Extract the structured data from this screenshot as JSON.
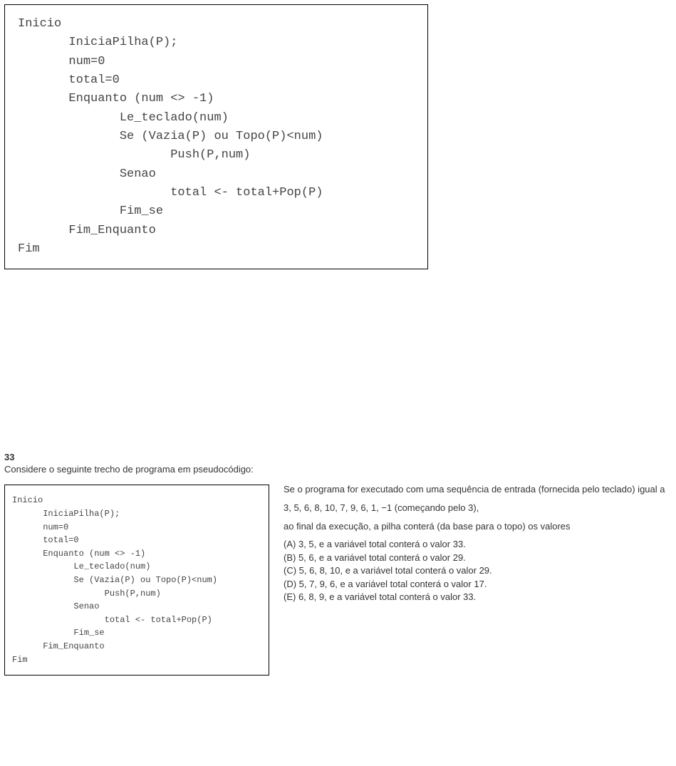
{
  "topCode": "Inicio\n       IniciaPilha(P);\n       num=0\n       total=0\n       Enquanto (num <> -1)\n              Le_teclado(num)\n              Se (Vazia(P) ou Topo(P)<num)\n                     Push(P,num)\n              Senao\n                     total <- total+Pop(P)\n              Fim_se\n       Fim_Enquanto\nFim",
  "question": {
    "number": "33",
    "intro": "Considere o seguinte trecho de programa em pseudocódigo:"
  },
  "bottomCode": "Inicio\n      IniciaPilha(P);\n      num=0\n      total=0\n      Enquanto (num <> -1)\n            Le_teclado(num)\n            Se (Vazia(P) ou Topo(P)<num)\n                  Push(P,num)\n            Senao\n                  total <- total+Pop(P)\n            Fim_se\n      Fim_Enquanto\nFim",
  "right": {
    "p1": "Se o programa for executado com uma sequência de entrada (fornecida pelo teclado) igual a",
    "seq": "3, 5, 6, 8, 10, 7, 9, 6, 1, −1     (começando pelo 3),",
    "p2": "ao final da execução, a pilha conterá (da base para o topo) os valores",
    "options": {
      "a": "(A) 3, 5, e a variável total conterá o valor 33.",
      "b": "(B) 5, 6, e a variável total conterá o valor 29.",
      "c": "(C) 5, 6, 8, 10, e a variável total conterá o valor 29.",
      "d": "(D) 5, 7, 9, 6, e a variável total conterá o valor 17.",
      "e": "(E) 6, 8, 9, e a variável total conterá o valor 33."
    }
  }
}
